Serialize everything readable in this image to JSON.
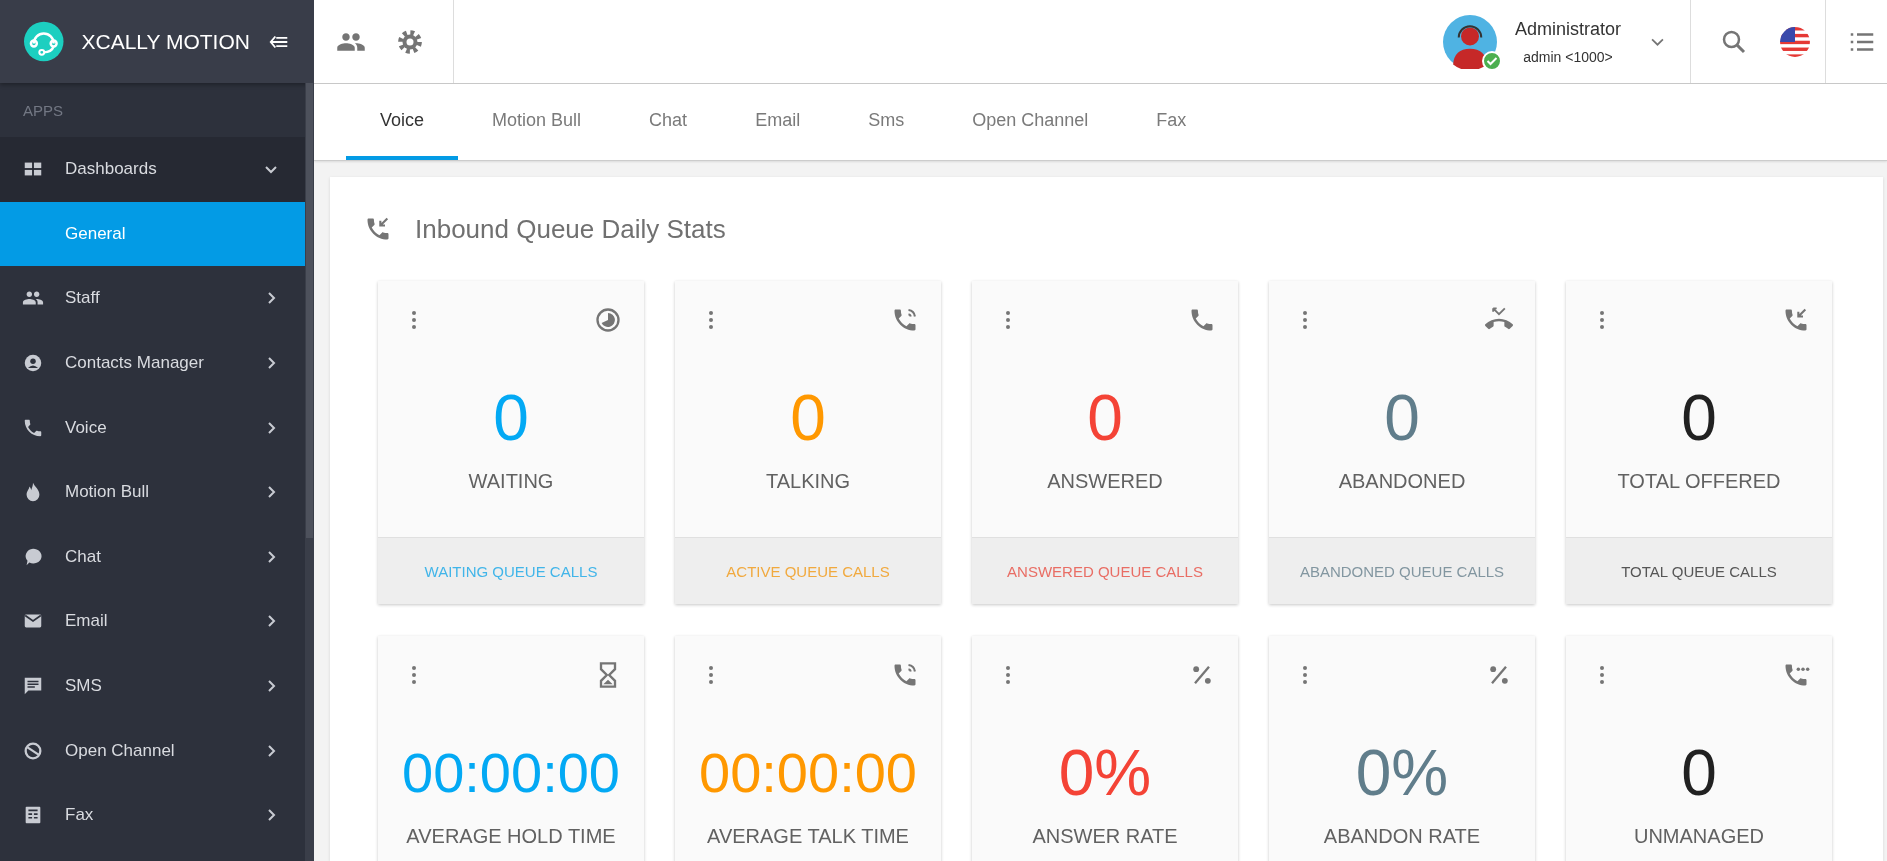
{
  "brand": {
    "name": "XCALLY MOTION"
  },
  "sidebar": {
    "section": "APPS",
    "items": [
      {
        "kind": "dashboards",
        "label": "Dashboards",
        "expanded": true,
        "children": [
          {
            "label": "General",
            "selected": true
          }
        ]
      },
      {
        "kind": "staff",
        "label": "Staff",
        "expanded": false
      },
      {
        "kind": "contacts",
        "label": "Contacts Manager",
        "expanded": false
      },
      {
        "kind": "voice",
        "label": "Voice",
        "expanded": false
      },
      {
        "kind": "motionbull",
        "label": "Motion Bull",
        "expanded": false
      },
      {
        "kind": "chat",
        "label": "Chat",
        "expanded": false
      },
      {
        "kind": "email",
        "label": "Email",
        "expanded": false
      },
      {
        "kind": "sms",
        "label": "SMS",
        "expanded": false
      },
      {
        "kind": "openchannel",
        "label": "Open Channel",
        "expanded": false
      },
      {
        "kind": "fax",
        "label": "Fax",
        "expanded": false
      }
    ]
  },
  "user": {
    "name": "Administrator",
    "account": "admin <1000>",
    "online": true
  },
  "tabs": [
    {
      "label": "Voice",
      "selected": true
    },
    {
      "label": "Motion Bull",
      "selected": false
    },
    {
      "label": "Chat",
      "selected": false
    },
    {
      "label": "Email",
      "selected": false
    },
    {
      "label": "Sms",
      "selected": false
    },
    {
      "label": "Open Channel",
      "selected": false
    },
    {
      "label": "Fax",
      "selected": false
    }
  ],
  "panel": {
    "title": "Inbound Queue Daily Stats",
    "cards": [
      {
        "kind": "waiting",
        "value": "0",
        "label": "WAITING",
        "footer": "WAITING QUEUE CALLS",
        "color": "#03a9f4"
      },
      {
        "kind": "talking",
        "value": "0",
        "label": "TALKING",
        "footer": "ACTIVE QUEUE CALLS",
        "color": "#ff9800"
      },
      {
        "kind": "answered",
        "value": "0",
        "label": "ANSWERED",
        "footer": "ANSWERED QUEUE CALLS",
        "color": "#f44336"
      },
      {
        "kind": "abandoned",
        "value": "0",
        "label": "ABANDONED",
        "footer": "ABANDONED QUEUE CALLS",
        "color": "#607d8b"
      },
      {
        "kind": "inbound",
        "value": "0",
        "label": "TOTAL OFFERED",
        "footer": "TOTAL QUEUE CALLS",
        "color": "#212121"
      },
      {
        "kind": "hourglass",
        "value": "00:00:00",
        "label": "AVERAGE HOLD TIME",
        "color": "#03a9f4"
      },
      {
        "kind": "talking",
        "value": "00:00:00",
        "label": "AVERAGE TALK TIME",
        "color": "#ff9800"
      },
      {
        "kind": "percent",
        "value": "0%",
        "label": "ANSWER RATE",
        "color": "#f44336"
      },
      {
        "kind": "percent",
        "value": "0%",
        "label": "ABANDON RATE",
        "color": "#607d8b"
      },
      {
        "kind": "unmanaged",
        "value": "0",
        "label": "UNMANAGED",
        "color": "#212121"
      }
    ]
  }
}
